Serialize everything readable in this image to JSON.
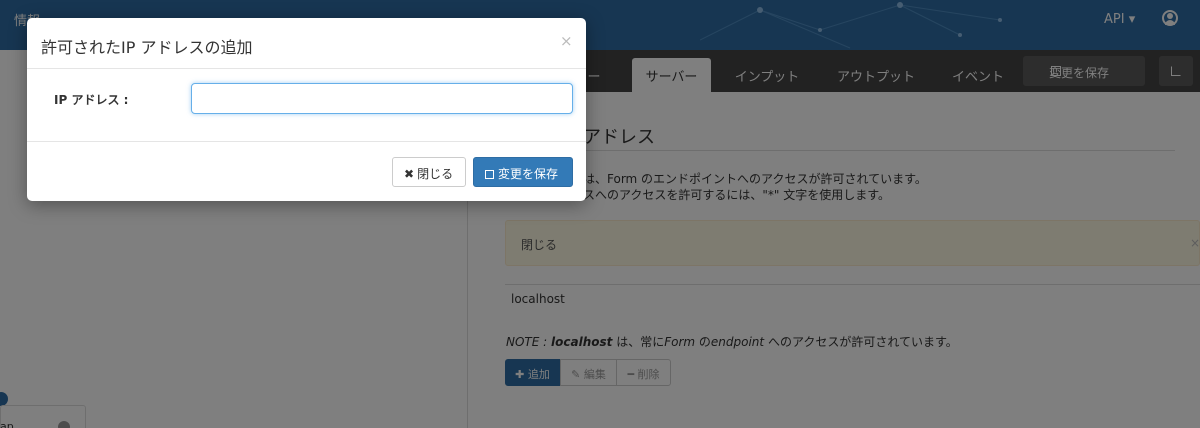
{
  "navbar": {
    "brand": "情報",
    "api_menu": "API ▾"
  },
  "tabs": [
    {
      "label": "ー"
    },
    {
      "label": "サーバー"
    },
    {
      "label": "インプット"
    },
    {
      "label": "アウトプット"
    },
    {
      "label": "イベント"
    }
  ],
  "toolbar": {
    "save_label": "変更を保存"
  },
  "section": {
    "title": "アドレス",
    "desc_line1": "は、Form のエンドポイントへのアクセスが許可されています。",
    "desc_line2": "スへのアクセスを許可するには、\"*\" 文字を使用します。"
  },
  "alert": {
    "text": "閉じる",
    "close": "×"
  },
  "list": {
    "items": [
      "localhost"
    ]
  },
  "note": {
    "prefix": "NOTE : ",
    "host": "localhost",
    "mid1": " は、常に",
    "form": "Form",
    "mid2": " の",
    "endpoint": "endpoint",
    "suffix": " へのアクセスが許可されています。"
  },
  "actions": {
    "add": "✚ 追加",
    "edit": "✎ 編集",
    "delete": "━ 削除"
  },
  "left": {
    "card_text": "ap"
  },
  "modal": {
    "title": "許可されたIP アドレスの追加",
    "close_x": "×",
    "field_label": "IP アドレス :",
    "field_value": "",
    "close_button": "閉じる",
    "save_button": "変更を保存"
  },
  "colors": {
    "navbar": "#2e6da4",
    "primary": "#337ab7",
    "tabbar": "#444444",
    "alert_bg": "#fcf8e3"
  }
}
